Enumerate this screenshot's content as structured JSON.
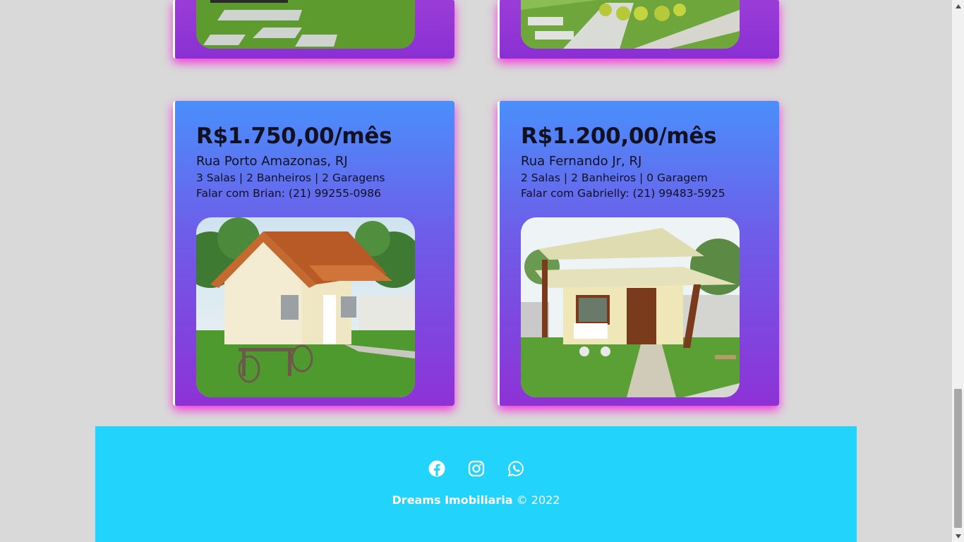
{
  "listings": [
    {
      "price": "R$1.750,00/mês",
      "street": "Rua Porto Amazonas, RJ",
      "rooms": "3 Salas | 2 Banheiros | 2 Garagens",
      "contact": "Falar com Brian: (21) 99255-0986"
    },
    {
      "price": "R$1.200,00/mês",
      "street": "Rua Fernando Jr, RJ",
      "rooms": "2 Salas | 2 Banheiros | 0 Garagem",
      "contact": "Falar com Gabrielly: (21) 99483-5925"
    }
  ],
  "footer": {
    "brand": "Dreams Imobiliaria",
    "copyright_suffix": " © 2022",
    "social_icons": [
      "facebook-icon",
      "instagram-icon",
      "whatsapp-icon"
    ]
  },
  "colors": {
    "background": "#d9d9d9",
    "card_gradient_top": "#4a8ffb",
    "card_gradient_bottom": "#8e32d6",
    "card_glow": "#ff00dc",
    "footer": "#22d3fb",
    "text": "#111122"
  }
}
